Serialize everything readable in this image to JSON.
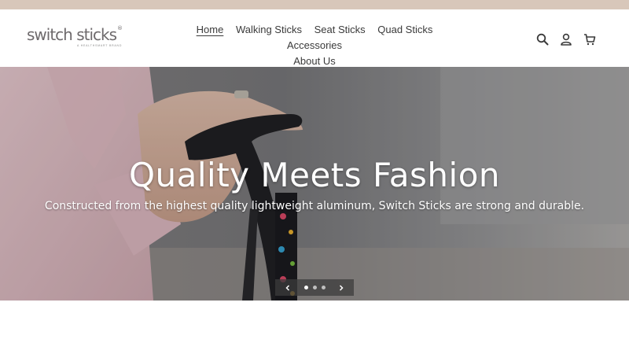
{
  "brand": {
    "name": "switch sticks",
    "registered_mark": "®",
    "tagline": "A HEALTHSMART BRAND"
  },
  "nav": {
    "items": [
      {
        "label": "Home",
        "active": true
      },
      {
        "label": "Walking Sticks",
        "active": false
      },
      {
        "label": "Seat Sticks",
        "active": false
      },
      {
        "label": "Quad Sticks",
        "active": false
      },
      {
        "label": "Accessories",
        "active": false
      },
      {
        "label": "About Us",
        "active": false
      }
    ]
  },
  "header_icons": [
    "search-icon",
    "account-icon",
    "cart-icon"
  ],
  "hero": {
    "title": "Quality Meets Fashion",
    "subtitle": "Constructed from the highest quality lightweight aluminum, Switch Sticks are strong and durable."
  },
  "slider": {
    "slide_count": 3,
    "active_slide": 1
  },
  "colors": {
    "announcement_bar": "#d8c7ba",
    "text": "#3a3a3a",
    "logo": "#6e6a6c",
    "slider_bg": "#3c3c3c"
  }
}
